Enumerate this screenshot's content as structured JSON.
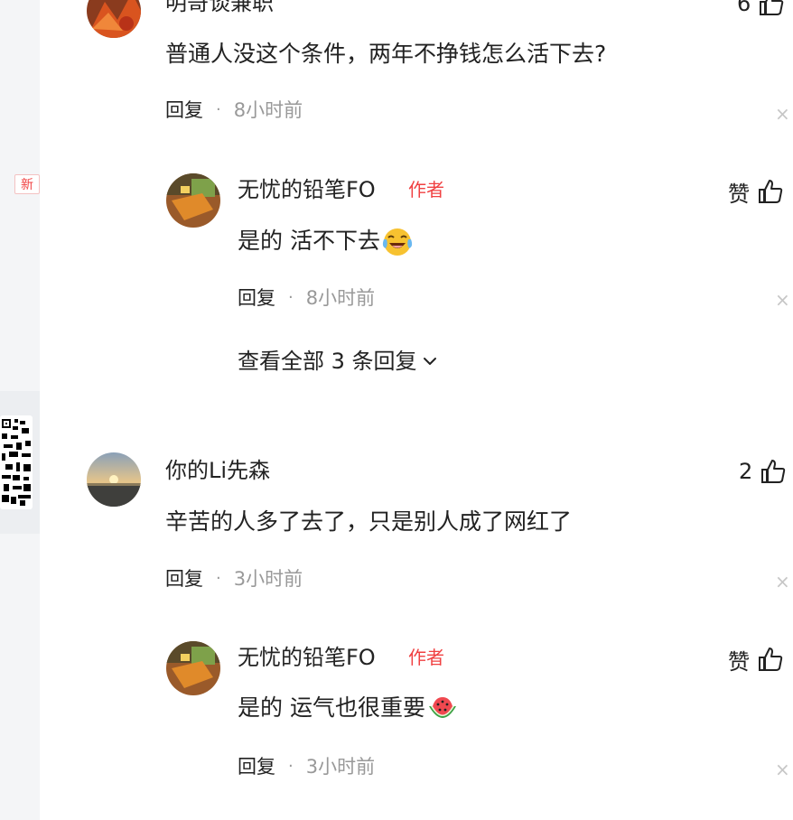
{
  "sidebar": {
    "new_badge": "新"
  },
  "comments": [
    {
      "username": "明哥谈兼职",
      "content": "普通人没这个条件，两年不挣钱怎么活下去?",
      "reply_label": "回复",
      "time": "8小时前",
      "likes": "6",
      "close": "×",
      "sub_reply": {
        "username": "无忧的铅笔FO",
        "author_tag": "作者",
        "content": "是的 活不下去",
        "emoji": "laughing-tears-emoji",
        "reply_label": "回复",
        "time": "8小时前",
        "likes": "赞",
        "close": "×"
      },
      "view_all": "查看全部 3 条回复"
    },
    {
      "username": "你的Li先森",
      "content": "辛苦的人多了去了，只是别人成了网红了",
      "reply_label": "回复",
      "time": "3小时前",
      "likes": "2",
      "close": "×",
      "sub_reply": {
        "username": "无忧的铅笔FO",
        "author_tag": "作者",
        "content": "是的 运气也很重要",
        "emoji": "watermelon-emoji",
        "reply_label": "回复",
        "time": "3小时前",
        "likes": "赞",
        "close": "×"
      }
    }
  ],
  "colors": {
    "author_tag": "#f04142",
    "muted": "#999999",
    "text": "#222222"
  }
}
